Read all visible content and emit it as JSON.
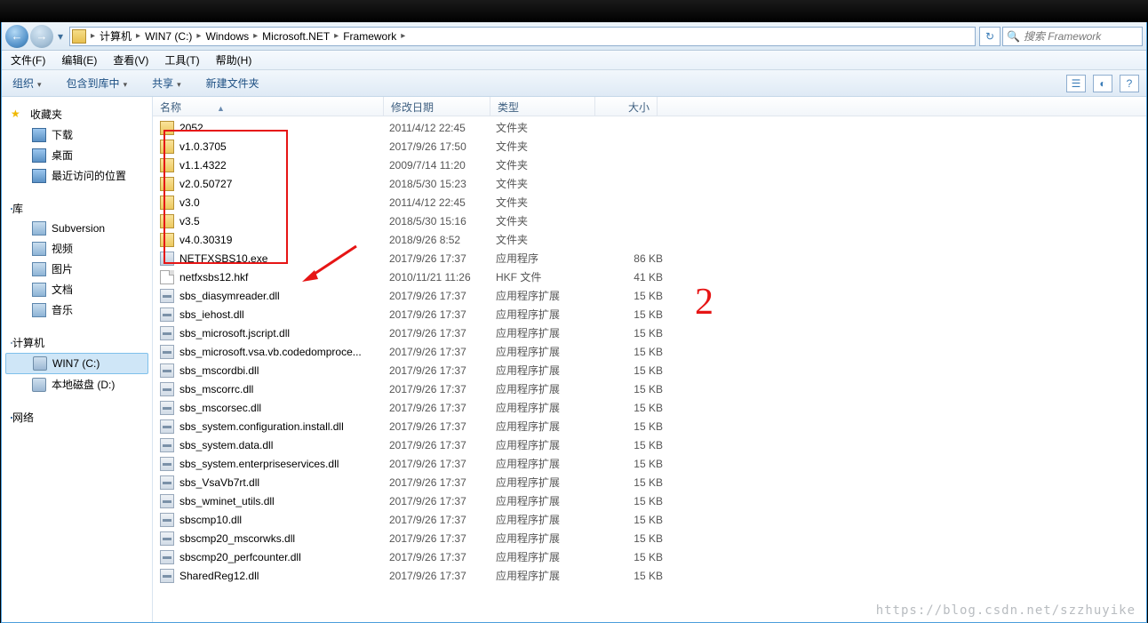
{
  "nav": {
    "back_icon": "←",
    "fwd_icon": "→",
    "drop_icon": "▾",
    "refresh_icon": "↻"
  },
  "breadcrumb": {
    "root_icon": "folder",
    "items": [
      "计算机",
      "WIN7 (C:)",
      "Windows",
      "Microsoft.NET",
      "Framework"
    ],
    "sep": "▸"
  },
  "search": {
    "placeholder": "搜索 Framework",
    "mag": "🔍"
  },
  "menu": {
    "file": "文件(F)",
    "edit": "编辑(E)",
    "view": "查看(V)",
    "tools": "工具(T)",
    "help": "帮助(H)"
  },
  "toolbar": {
    "organize": "组织",
    "include": "包含到库中",
    "share": "共享",
    "newfolder": "新建文件夹",
    "tri": "▾"
  },
  "sidebar": {
    "fav": "收藏夹",
    "fav_items": [
      "下载",
      "桌面",
      "最近访问的位置"
    ],
    "lib": "库",
    "lib_items": [
      "Subversion",
      "视频",
      "图片",
      "文档",
      "音乐"
    ],
    "computer": "计算机",
    "comp_items": [
      "WIN7 (C:)",
      "本地磁盘 (D:)"
    ],
    "network": "网络"
  },
  "columns": {
    "name": "名称",
    "date": "修改日期",
    "type": "类型",
    "size": "大小"
  },
  "files": [
    {
      "icon": "folder",
      "name": "2052",
      "date": "2011/4/12 22:45",
      "type": "文件夹",
      "size": ""
    },
    {
      "icon": "folder",
      "name": "v1.0.3705",
      "date": "2017/9/26 17:50",
      "type": "文件夹",
      "size": ""
    },
    {
      "icon": "folder",
      "name": "v1.1.4322",
      "date": "2009/7/14 11:20",
      "type": "文件夹",
      "size": ""
    },
    {
      "icon": "folder",
      "name": "v2.0.50727",
      "date": "2018/5/30 15:23",
      "type": "文件夹",
      "size": ""
    },
    {
      "icon": "folder",
      "name": "v3.0",
      "date": "2011/4/12 22:45",
      "type": "文件夹",
      "size": ""
    },
    {
      "icon": "folder",
      "name": "v3.5",
      "date": "2018/5/30 15:16",
      "type": "文件夹",
      "size": ""
    },
    {
      "icon": "folder",
      "name": "v4.0.30319",
      "date": "2018/9/26 8:52",
      "type": "文件夹",
      "size": ""
    },
    {
      "icon": "exe",
      "name": "NETFXSBS10.exe",
      "date": "2017/9/26 17:37",
      "type": "应用程序",
      "size": "86 KB"
    },
    {
      "icon": "file",
      "name": "netfxsbs12.hkf",
      "date": "2010/11/21 11:26",
      "type": "HKF 文件",
      "size": "41 KB"
    },
    {
      "icon": "dll",
      "name": "sbs_diasymreader.dll",
      "date": "2017/9/26 17:37",
      "type": "应用程序扩展",
      "size": "15 KB"
    },
    {
      "icon": "dll",
      "name": "sbs_iehost.dll",
      "date": "2017/9/26 17:37",
      "type": "应用程序扩展",
      "size": "15 KB"
    },
    {
      "icon": "dll",
      "name": "sbs_microsoft.jscript.dll",
      "date": "2017/9/26 17:37",
      "type": "应用程序扩展",
      "size": "15 KB"
    },
    {
      "icon": "dll",
      "name": "sbs_microsoft.vsa.vb.codedomproce...",
      "date": "2017/9/26 17:37",
      "type": "应用程序扩展",
      "size": "15 KB"
    },
    {
      "icon": "dll",
      "name": "sbs_mscordbi.dll",
      "date": "2017/9/26 17:37",
      "type": "应用程序扩展",
      "size": "15 KB"
    },
    {
      "icon": "dll",
      "name": "sbs_mscorrc.dll",
      "date": "2017/9/26 17:37",
      "type": "应用程序扩展",
      "size": "15 KB"
    },
    {
      "icon": "dll",
      "name": "sbs_mscorsec.dll",
      "date": "2017/9/26 17:37",
      "type": "应用程序扩展",
      "size": "15 KB"
    },
    {
      "icon": "dll",
      "name": "sbs_system.configuration.install.dll",
      "date": "2017/9/26 17:37",
      "type": "应用程序扩展",
      "size": "15 KB"
    },
    {
      "icon": "dll",
      "name": "sbs_system.data.dll",
      "date": "2017/9/26 17:37",
      "type": "应用程序扩展",
      "size": "15 KB"
    },
    {
      "icon": "dll",
      "name": "sbs_system.enterpriseservices.dll",
      "date": "2017/9/26 17:37",
      "type": "应用程序扩展",
      "size": "15 KB"
    },
    {
      "icon": "dll",
      "name": "sbs_VsaVb7rt.dll",
      "date": "2017/9/26 17:37",
      "type": "应用程序扩展",
      "size": "15 KB"
    },
    {
      "icon": "dll",
      "name": "sbs_wminet_utils.dll",
      "date": "2017/9/26 17:37",
      "type": "应用程序扩展",
      "size": "15 KB"
    },
    {
      "icon": "dll",
      "name": "sbscmp10.dll",
      "date": "2017/9/26 17:37",
      "type": "应用程序扩展",
      "size": "15 KB"
    },
    {
      "icon": "dll",
      "name": "sbscmp20_mscorwks.dll",
      "date": "2017/9/26 17:37",
      "type": "应用程序扩展",
      "size": "15 KB"
    },
    {
      "icon": "dll",
      "name": "sbscmp20_perfcounter.dll",
      "date": "2017/9/26 17:37",
      "type": "应用程序扩展",
      "size": "15 KB"
    },
    {
      "icon": "dll",
      "name": "SharedReg12.dll",
      "date": "2017/9/26 17:37",
      "type": "应用程序扩展",
      "size": "15 KB"
    }
  ],
  "annotation": {
    "two": "2"
  },
  "watermark": "https://blog.csdn.net/szzhuyike"
}
